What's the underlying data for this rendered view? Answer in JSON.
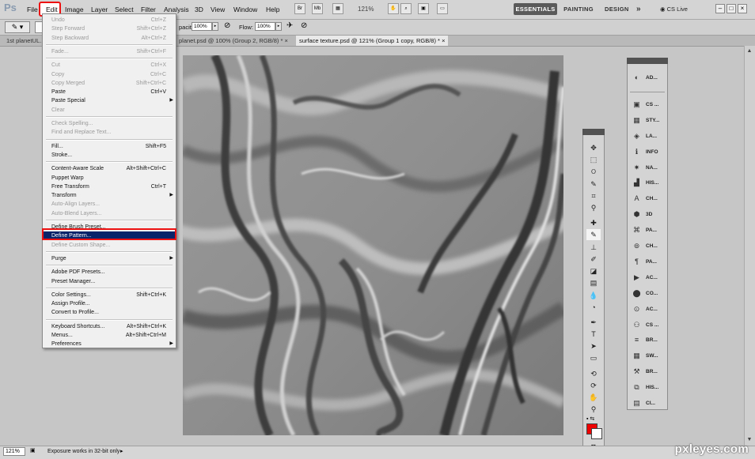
{
  "app": {
    "logo": "Ps"
  },
  "menubar": {
    "items": [
      "File",
      "Edit",
      "Image",
      "Layer",
      "Select",
      "Filter",
      "Analysis",
      "3D",
      "View",
      "Window",
      "Help"
    ],
    "toolbar_buttons": [
      "Br",
      "Mb"
    ],
    "zoom": "121%",
    "workspaces": [
      "ESSENTIALS",
      "PAINTING",
      "DESIGN"
    ],
    "more": "»",
    "cs_live": "CS Live"
  },
  "options_bar": {
    "opacity_label": "pacity:",
    "opacity_value": "100%",
    "flow_label": "Flow:",
    "flow_value": "100%"
  },
  "tabs": [
    {
      "label": "1st planetUL..."
    },
    {
      "label": "planet.psd @ 100% (Group 2, RGB/8) *"
    },
    {
      "label": "surface texture.psd @ 121% (Group 1 copy, RGB/8) *"
    }
  ],
  "edit_menu": [
    {
      "label": "Undo",
      "shortcut": "Ctrl+Z",
      "disabled": true
    },
    {
      "label": "Step Forward",
      "shortcut": "Shift+Ctrl+Z",
      "disabled": true
    },
    {
      "label": "Step Backward",
      "shortcut": "Alt+Ctrl+Z",
      "disabled": true
    },
    {
      "sep": true
    },
    {
      "label": "Fade...",
      "shortcut": "Shift+Ctrl+F",
      "disabled": true
    },
    {
      "sep": true
    },
    {
      "label": "Cut",
      "shortcut": "Ctrl+X",
      "disabled": true
    },
    {
      "label": "Copy",
      "shortcut": "Ctrl+C",
      "disabled": true
    },
    {
      "label": "Copy Merged",
      "shortcut": "Shift+Ctrl+C",
      "disabled": true
    },
    {
      "label": "Paste",
      "shortcut": "Ctrl+V"
    },
    {
      "label": "Paste Special",
      "submenu": true
    },
    {
      "label": "Clear",
      "disabled": true
    },
    {
      "sep": true
    },
    {
      "label": "Check Spelling...",
      "disabled": true
    },
    {
      "label": "Find and Replace Text...",
      "disabled": true
    },
    {
      "sep": true
    },
    {
      "label": "Fill...",
      "shortcut": "Shift+F5"
    },
    {
      "label": "Stroke..."
    },
    {
      "sep": true
    },
    {
      "label": "Content-Aware Scale",
      "shortcut": "Alt+Shift+Ctrl+C"
    },
    {
      "label": "Puppet Warp"
    },
    {
      "label": "Free Transform",
      "shortcut": "Ctrl+T"
    },
    {
      "label": "Transform",
      "submenu": true
    },
    {
      "label": "Auto-Align Layers...",
      "disabled": true
    },
    {
      "label": "Auto-Blend Layers...",
      "disabled": true
    },
    {
      "sep": true
    },
    {
      "label": "Define Brush Preset..."
    },
    {
      "label": "Define Pattern...",
      "highlighted": true
    },
    {
      "label": "Define Custom Shape...",
      "disabled": true
    },
    {
      "sep": true
    },
    {
      "label": "Purge",
      "submenu": true
    },
    {
      "sep": true
    },
    {
      "label": "Adobe PDF Presets..."
    },
    {
      "label": "Preset Manager..."
    },
    {
      "sep": true
    },
    {
      "label": "Color Settings...",
      "shortcut": "Shift+Ctrl+K"
    },
    {
      "label": "Assign Profile..."
    },
    {
      "label": "Convert to Profile..."
    },
    {
      "sep": true
    },
    {
      "label": "Keyboard Shortcuts...",
      "shortcut": "Alt+Shift+Ctrl+K"
    },
    {
      "label": "Menus...",
      "shortcut": "Alt+Shift+Ctrl+M"
    },
    {
      "label": "Preferences",
      "submenu": true
    }
  ],
  "panels": [
    {
      "icon": "adjustments-icon",
      "label": "AD..."
    },
    {
      "sep": true
    },
    {
      "icon": "clone-source-icon",
      "label": "CS ..."
    },
    {
      "icon": "styles-icon",
      "label": "STY..."
    },
    {
      "icon": "layers-icon",
      "label": "LA..."
    },
    {
      "icon": "info-icon",
      "label": "INFO"
    },
    {
      "icon": "navigator-icon",
      "label": "NA..."
    },
    {
      "icon": "histogram-icon",
      "label": "HIS..."
    },
    {
      "icon": "character-icon",
      "label": "CH..."
    },
    {
      "icon": "3d-icon",
      "label": "3D"
    },
    {
      "icon": "paths-icon",
      "label": "PA..."
    },
    {
      "icon": "channels-icon",
      "label": "CH..."
    },
    {
      "icon": "paragraph-icon",
      "label": "PA..."
    },
    {
      "icon": "actions-icon",
      "label": "AC..."
    },
    {
      "icon": "color-icon",
      "label": "CO..."
    },
    {
      "icon": "actions2-icon",
      "label": "AC..."
    },
    {
      "icon": "clone-icon",
      "label": "CS ..."
    },
    {
      "icon": "brush-icon",
      "label": "BR..."
    },
    {
      "icon": "swatches-icon",
      "label": "SW..."
    },
    {
      "icon": "brush-presets-icon",
      "label": "BR..."
    },
    {
      "icon": "history-icon",
      "label": "HIS..."
    },
    {
      "icon": "clone2-icon",
      "label": "CI..."
    }
  ],
  "status": {
    "zoom": "121%",
    "text": "Exposure works in 32-bit only"
  },
  "watermark": "pxleyes.com",
  "colors": {
    "foreground": "#e00000",
    "background": "#ffffff",
    "highlight": "#0a246a",
    "annotation": "#e11111"
  }
}
